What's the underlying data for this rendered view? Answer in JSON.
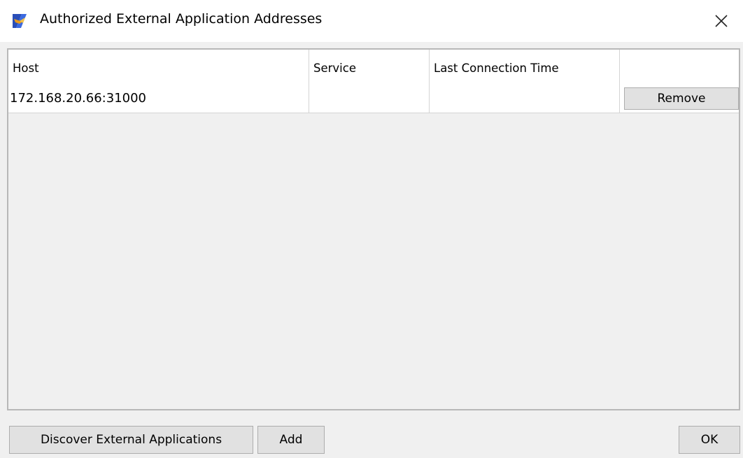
{
  "window": {
    "title": "Authorized External Application Addresses",
    "icon": "app-icon"
  },
  "table": {
    "columns": [
      "Host",
      "Service",
      "Last Connection Time",
      ""
    ],
    "rows": [
      {
        "host": "172.168.20.66:31000",
        "service": "",
        "last_connection_time": "",
        "action_label": "Remove"
      }
    ]
  },
  "buttons": {
    "discover": "Discover External Applications",
    "add": "Add",
    "ok": "OK"
  }
}
